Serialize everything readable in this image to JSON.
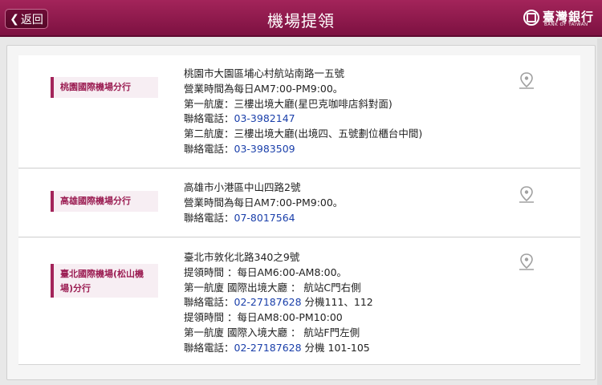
{
  "header": {
    "back_label": "返回",
    "title": "機場提領",
    "logo_name": "臺灣銀行",
    "logo_en": "BANK OF TAIWAN"
  },
  "branches": [
    {
      "name": "桃園國際機場分行",
      "lines": [
        {
          "text": "桃園市大園區埔心村航站南路一五號"
        },
        {
          "text": "營業時間為每日AM7:00-PM9:00。"
        },
        {
          "text": "第一航廈：三樓出境大廳(星巴克咖啡店斜對面)"
        },
        {
          "label": "聯絡電話：",
          "phone": "03-3982147",
          "suffix": ""
        },
        {
          "text": "第二航廈：三樓出境大廳(出境四、五號劃位櫃台中間)"
        },
        {
          "label": "聯絡電話：",
          "phone": "03-3983509",
          "suffix": ""
        }
      ]
    },
    {
      "name": "高雄國際機場分行",
      "lines": [
        {
          "text": "高雄市小港區中山四路2號"
        },
        {
          "text": "營業時間為每日AM7:00-PM9:00。"
        },
        {
          "label": "聯絡電話：",
          "phone": "07-8017564",
          "suffix": ""
        }
      ]
    },
    {
      "name": "臺北國際機場(松山機場)分行",
      "lines": [
        {
          "text": "臺北市敦化北路340之9號"
        },
        {
          "text": "提領時間 ：每日AM6:00-AM8:00。"
        },
        {
          "text": "第一航廈 國際出境大廳 ： 航站C門右側"
        },
        {
          "label": "聯絡電話：",
          "phone": "02-27187628",
          "suffix": " 分機111、112"
        },
        {
          "text": "提領時間 ：每日AM8:00-PM10:00"
        },
        {
          "text": "第一航廈 國際入境大廳 ： 航站F門左側"
        },
        {
          "label": "聯絡電話：",
          "phone": "02-27187628",
          "suffix": " 分機 101-105"
        }
      ]
    }
  ],
  "icons": {
    "back": "chevron-left-icon",
    "map": "map-pin-icon",
    "logo": "bank-seal-icon"
  },
  "colors": {
    "brand": "#8b1548",
    "phone": "#1a3faa"
  }
}
